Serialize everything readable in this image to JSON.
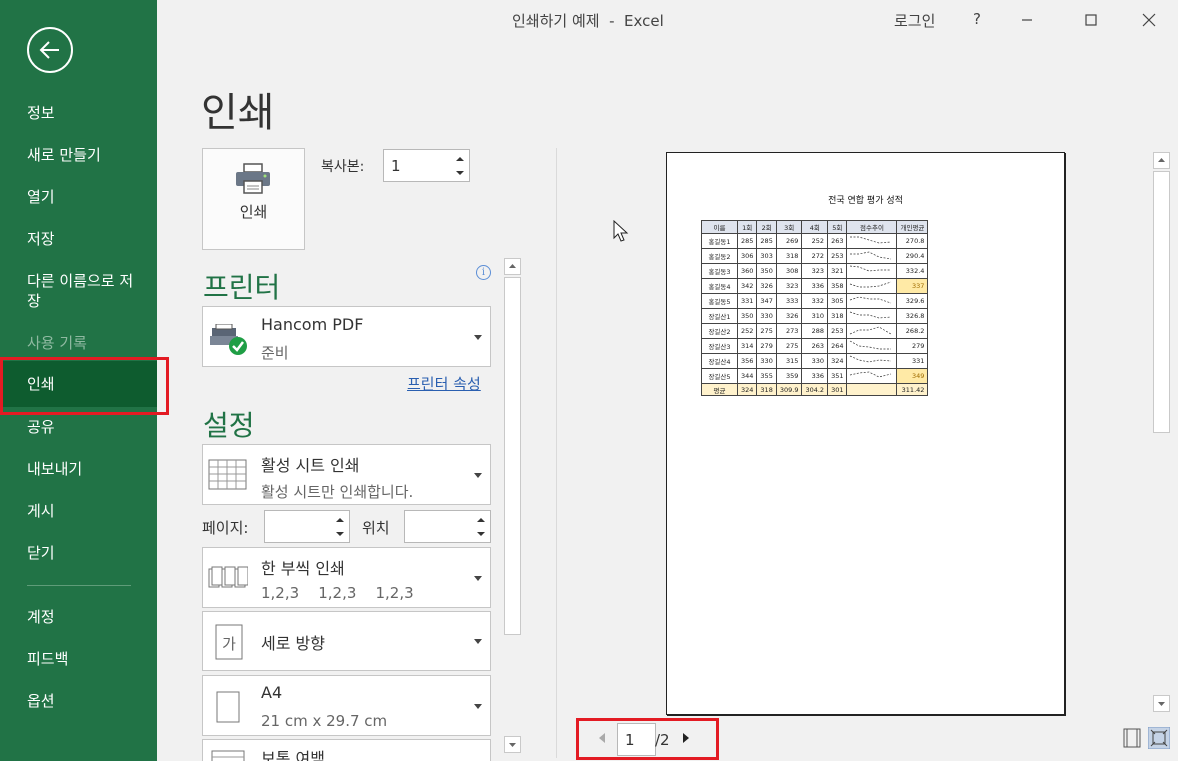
{
  "window": {
    "title": "인쇄하기 예제  -  Excel",
    "login": "로그인",
    "help": "?"
  },
  "sidebar": {
    "items": [
      {
        "label": "정보"
      },
      {
        "label": "새로 만들기"
      },
      {
        "label": "열기"
      },
      {
        "label": "저장"
      },
      {
        "label": "다른 이름으로 저장"
      },
      {
        "label": "사용 기록"
      },
      {
        "label": "인쇄"
      },
      {
        "label": "공유"
      },
      {
        "label": "내보내기"
      },
      {
        "label": "게시"
      },
      {
        "label": "닫기"
      },
      {
        "label": "계정"
      },
      {
        "label": "피드백"
      },
      {
        "label": "옵션"
      }
    ]
  },
  "print": {
    "heading": "인쇄",
    "button_label": "인쇄",
    "copies_label": "복사본:",
    "copies_value": "1"
  },
  "printer": {
    "section_title": "프린터",
    "name": "Hancom PDF",
    "status": "준비",
    "properties_link": "프린터 속성"
  },
  "settings": {
    "section_title": "설정",
    "what": {
      "title": "활성 시트 인쇄",
      "desc": "활성 시트만 인쇄합니다."
    },
    "pages_label": "페이지:",
    "to_label": "위치",
    "collate": {
      "title": "한 부씩 인쇄",
      "desc": "1,2,3    1,2,3    1,2,3"
    },
    "orientation": {
      "title": "세로 방향"
    },
    "paper": {
      "title": "A4",
      "desc": "21 cm x 29.7 cm"
    },
    "margins": {
      "title": "보통 여백"
    }
  },
  "preview": {
    "title": "전국 연합 평가 성적",
    "headers": [
      "이름",
      "1회",
      "2회",
      "3회",
      "4회",
      "5회",
      "점수추이",
      "개인평균"
    ],
    "rows": [
      {
        "name": "홍길동1",
        "scores": [
          "285",
          "285",
          "269",
          "252",
          "263"
        ],
        "avg": "270.8",
        "hl": false
      },
      {
        "name": "홍길동2",
        "scores": [
          "306",
          "303",
          "318",
          "272",
          "253"
        ],
        "avg": "290.4",
        "hl": false
      },
      {
        "name": "홍길동3",
        "scores": [
          "360",
          "350",
          "308",
          "323",
          "321"
        ],
        "avg": "332.4",
        "hl": false
      },
      {
        "name": "홍길동4",
        "scores": [
          "342",
          "326",
          "323",
          "336",
          "358"
        ],
        "avg": "337",
        "hl": true
      },
      {
        "name": "홍길동5",
        "scores": [
          "331",
          "347",
          "333",
          "332",
          "305"
        ],
        "avg": "329.6",
        "hl": false
      },
      {
        "name": "장길산1",
        "scores": [
          "350",
          "330",
          "326",
          "310",
          "318"
        ],
        "avg": "326.8",
        "hl": false
      },
      {
        "name": "장길산2",
        "scores": [
          "252",
          "275",
          "273",
          "288",
          "253"
        ],
        "avg": "268.2",
        "hl": false
      },
      {
        "name": "장길산3",
        "scores": [
          "314",
          "279",
          "275",
          "263",
          "264"
        ],
        "avg": "279",
        "hl": false
      },
      {
        "name": "장길산4",
        "scores": [
          "356",
          "330",
          "315",
          "330",
          "324"
        ],
        "avg": "331",
        "hl": false
      },
      {
        "name": "장길산5",
        "scores": [
          "344",
          "355",
          "359",
          "336",
          "351"
        ],
        "avg": "349",
        "hl": true
      }
    ],
    "avg_row": {
      "label": "평균",
      "values": [
        "324",
        "318",
        "309.9",
        "304.2",
        "301"
      ],
      "overall": "311.42"
    }
  },
  "pager": {
    "current": "1",
    "total": "/2"
  },
  "colors": {
    "sidebar": "#217346",
    "sidebar_active": "#0e5c2f",
    "accent": "#217346",
    "highlight_outline": "#e31b23",
    "link": "#2a5fb0"
  }
}
